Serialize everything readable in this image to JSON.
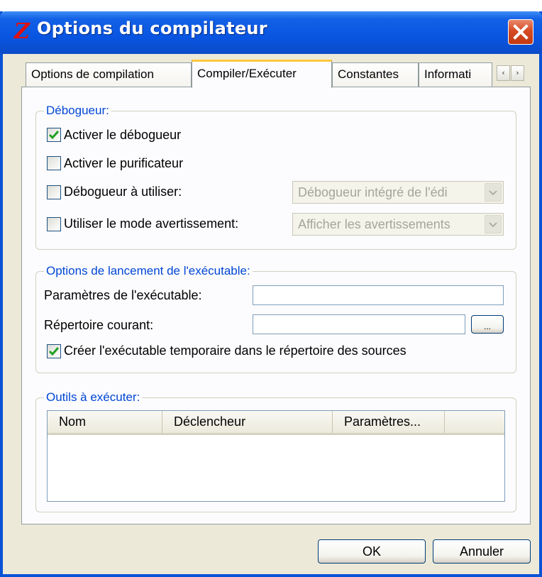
{
  "window": {
    "title": "Options du compilateur",
    "logo_glyph": "Z"
  },
  "tabs": [
    {
      "label": "Options de compilation"
    },
    {
      "label": "Compiler/Exécuter"
    },
    {
      "label": "Constantes"
    },
    {
      "label": "Informati"
    }
  ],
  "tab_scroll": {
    "left": "‹",
    "right": "›"
  },
  "debugger": {
    "legend": "Débogueur:",
    "enable_debugger": {
      "label": "Activer le débogueur",
      "checked": true
    },
    "enable_purifier": {
      "label": "Activer le purificateur",
      "checked": false
    },
    "debugger_to_use": {
      "label": "Débogueur à utiliser:",
      "checked": false,
      "value": "Débogueur intégré de l'édi"
    },
    "warning_mode": {
      "label": "Utiliser le mode avertissement:",
      "checked": false,
      "value": "Afficher les avertissements"
    }
  },
  "launch": {
    "legend": "Options de lancement de l'exécutable:",
    "params_label": "Paramètres de l'exécutable:",
    "params_value": "",
    "cwd_label": "Répertoire courant:",
    "cwd_value": "",
    "browse_label": "...",
    "temp_exe": {
      "label": "Créer l'exécutable temporaire dans le répertoire des sources",
      "checked": true
    }
  },
  "tools": {
    "legend": "Outils à exécuter:",
    "columns": [
      "Nom",
      "Déclencheur",
      "Paramètres..."
    ]
  },
  "buttons": {
    "ok": "OK",
    "cancel": "Annuler"
  },
  "colors": {
    "title_bar": "#0955e2",
    "legend_text": "#0046d5",
    "check_mark": "#21a121",
    "close_button": "#d64a22",
    "active_tab_accent": "#ffc83c"
  }
}
